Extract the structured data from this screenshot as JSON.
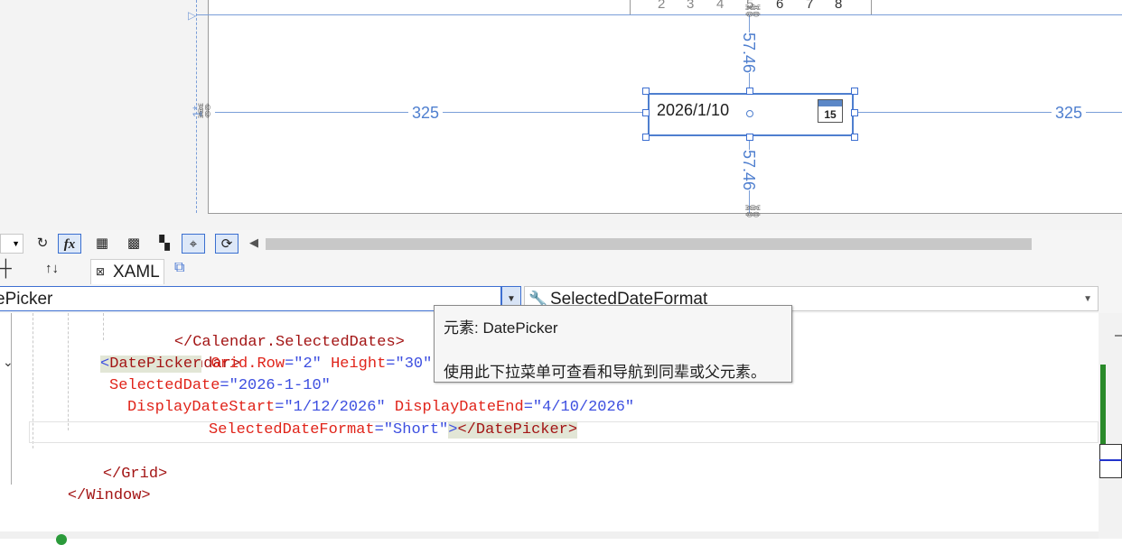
{
  "designer": {
    "calendar_days": [
      "2",
      "3",
      "4",
      "5",
      "6",
      "7",
      "8"
    ],
    "margin_left": "325",
    "margin_right": "325",
    "margin_top": "57.46",
    "margin_bottom": "57.46",
    "row_marker": "1*",
    "datepicker_text": "2026/1/10",
    "calendar_icon_day": "15"
  },
  "toolbar": {
    "fx_label": "fx"
  },
  "tabs": {
    "xaml_label": "XAML",
    "swap_label": "↑↓"
  },
  "nav": {
    "element_combo": "ePicker",
    "member_combo": "SelectedDateFormat"
  },
  "code": {
    "l1_close": "</Calendar.SelectedDates>",
    "l2_close": "</Calendar>",
    "l3_open": "<",
    "l3_tag": "DatePicker",
    "l3_attr1": " Grid.Row",
    "l3_eq1": "=",
    "l3_val1": "\"2\"",
    "l3_attr2": " Height",
    "l3_eq2": "=",
    "l3_val2": "\"30\"",
    "l4_attr": "SelectedDate",
    "l4_eq": "=",
    "l4_val": "\"2026-1-10\"",
    "l5_attr1": "DisplayDateStart",
    "l5_eq1": "=",
    "l5_val1": "\"1/12/2026\"",
    "l5_attr2": " DisplayDateEnd",
    "l5_eq2": "=",
    "l5_val2": "\"4/10/2026\"",
    "l6_attr": "SelectedDateFormat",
    "l6_eq": "=",
    "l6_val": "\"Short\"",
    "l6_close1": ">",
    "l6_close2": "</DatePicker>",
    "l7_close": "</Grid>",
    "l8_close": "</Window>"
  },
  "tooltip": {
    "title": "元素: DatePicker",
    "description": "使用此下拉菜单可查看和导航到同辈或父元素。"
  },
  "colors": {
    "accent": "#3d6fd1",
    "measure": "#4f7fcf",
    "xml_tag": "#a31515",
    "xml_attr": "#e0241a",
    "xml_value": "#3d4fe0"
  }
}
